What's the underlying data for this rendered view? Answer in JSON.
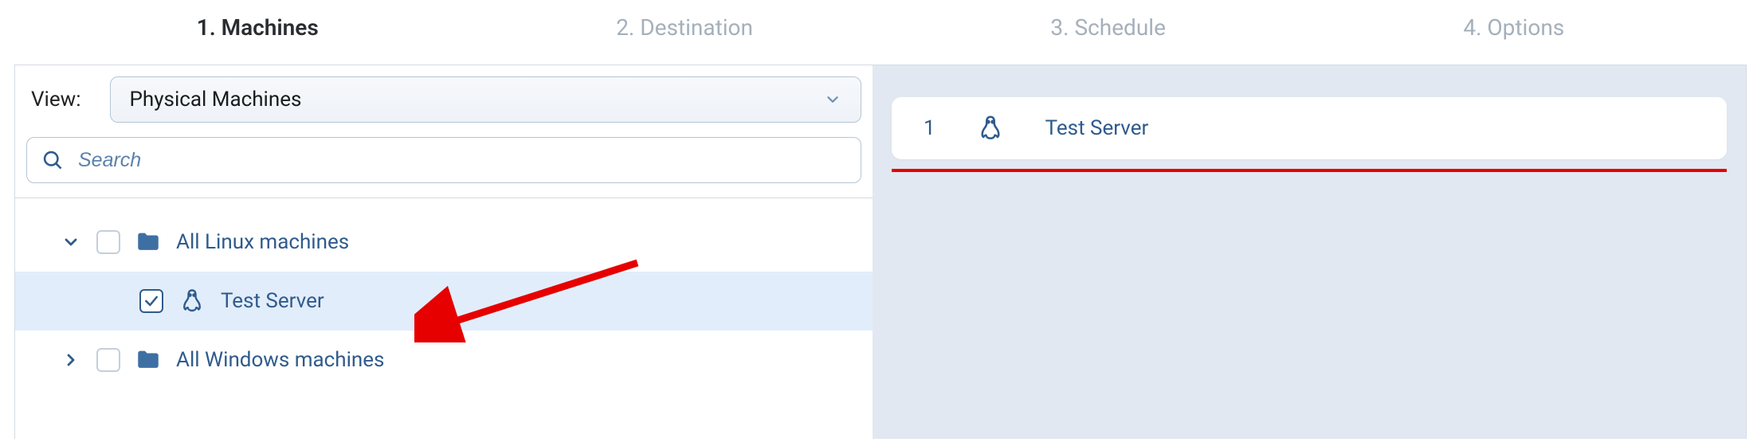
{
  "steps": {
    "s1": "1. Machines",
    "s2": "2. Destination",
    "s3": "3. Schedule",
    "s4": "4. Options"
  },
  "view": {
    "label": "View:",
    "value": "Physical Machines"
  },
  "search": {
    "placeholder": "Search"
  },
  "tree": {
    "linux_group": "All Linux machines",
    "test_server": "Test Server",
    "windows_group": "All Windows machines"
  },
  "selection": {
    "index": "1",
    "name": "Test Server"
  },
  "colors": {
    "accent": "#2f5b8c",
    "selected_row_bg": "#e2edfb",
    "right_pane_bg": "#e1e8f1",
    "annotation_red": "#e60000"
  }
}
